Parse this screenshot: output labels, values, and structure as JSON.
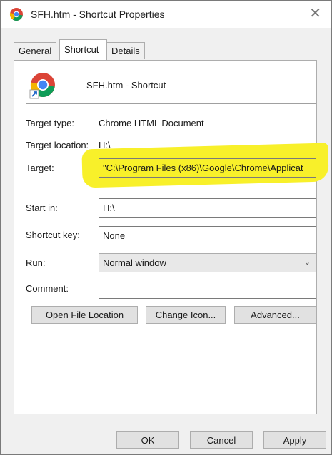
{
  "window": {
    "title": "SFH.htm - Shortcut Properties",
    "close_glyph": "✕"
  },
  "tabs": [
    {
      "label": "General"
    },
    {
      "label": "Shortcut"
    },
    {
      "label": "Details"
    }
  ],
  "shortcut": {
    "name": "SFH.htm - Shortcut",
    "target_type_label": "Target type:",
    "target_type_value": "Chrome HTML Document",
    "target_location_label": "Target location:",
    "target_location_value": "H:\\",
    "target_label": "Target:",
    "target_value": "\"C:\\Program Files (x86)\\Google\\Chrome\\Applicat",
    "start_in_label": "Start in:",
    "start_in_value": "H:\\",
    "shortcut_key_label": "Shortcut key:",
    "shortcut_key_value": "None",
    "run_label": "Run:",
    "run_value": "Normal window",
    "comment_label": "Comment:",
    "comment_value": ""
  },
  "buttons": {
    "open_file_location": "Open File Location",
    "change_icon": "Change Icon...",
    "advanced": "Advanced...",
    "ok": "OK",
    "cancel": "Cancel",
    "apply": "Apply"
  },
  "icons": {
    "app_icon": "chrome-shortcut-icon",
    "close": "close-icon",
    "dropdown": "chevron-down-icon"
  },
  "colors": {
    "highlight": "#f8f02a",
    "panel_bg": "#ffffff",
    "dialog_bg": "#f0f0f0"
  }
}
